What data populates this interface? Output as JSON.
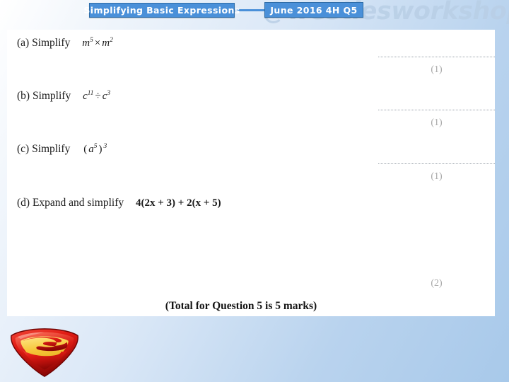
{
  "header": {
    "topic_label": "Simplifying Basic Expressions",
    "paper_label": "June 2016 4H Q5",
    "watermark": "@westiesworkshop"
  },
  "question": {
    "parts": [
      {
        "label": "(a)",
        "stem": "Simplify",
        "expression": "m5 × m2",
        "expr_base1": "m",
        "expr_exp1": "5",
        "expr_op": "×",
        "expr_base2": "m",
        "expr_exp2": "2",
        "marks": "(1)"
      },
      {
        "label": "(b)",
        "stem": "Simplify",
        "expression": "c11 ÷ c3",
        "expr_base1": "c",
        "expr_exp1": "11",
        "expr_op": "÷",
        "expr_base2": "c",
        "expr_exp2": "3",
        "marks": "(1)"
      },
      {
        "label": "(c)",
        "stem": "Simplify",
        "expression": "(a5)3",
        "expr_base1": "a",
        "expr_exp1": "5",
        "expr_exp2": "3",
        "marks": "(1)"
      },
      {
        "label": "(d)",
        "stem": "Expand and simplify",
        "expression": "4(2x + 3) + 2(x + 5)",
        "marks": "(2)"
      }
    ],
    "total_line": "(Total for Question 5 is 5 marks)"
  },
  "logo": {
    "name": "superman-shield-logo"
  },
  "colors": {
    "accent_blue": "#4a90d9",
    "accent_blue_border": "#2e6da8",
    "watermark_grey_blue": "#b9cfe6",
    "panel_white": "#ffffff",
    "mark_grey": "#a9a9a9"
  }
}
